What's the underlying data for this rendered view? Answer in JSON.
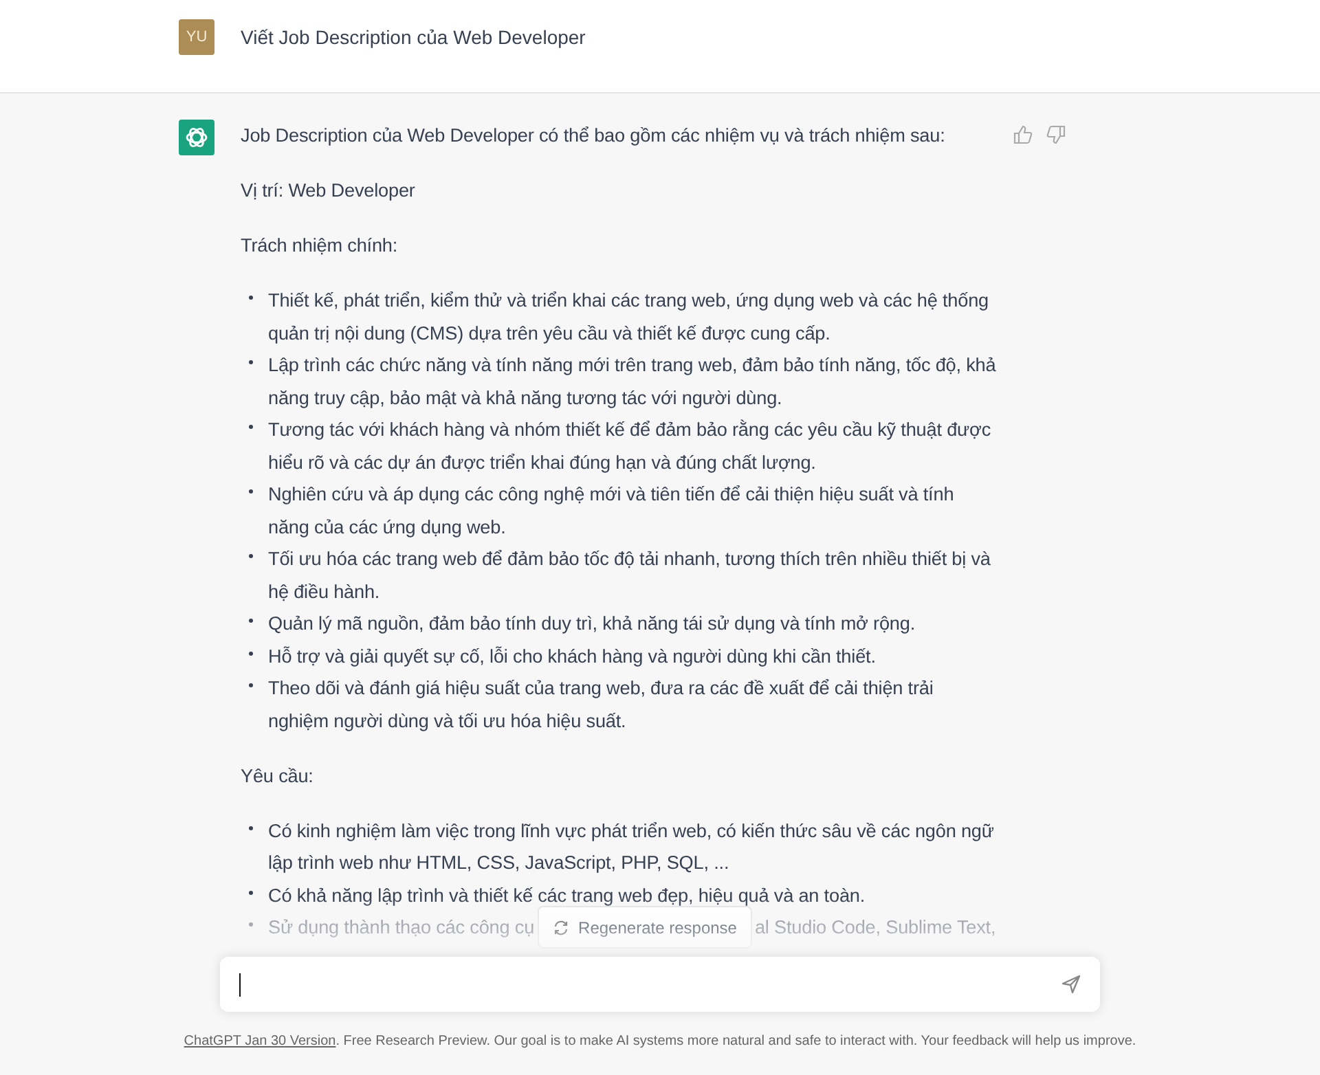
{
  "user_message": {
    "avatar": "YU",
    "text": "Viết Job Description của Web Developer"
  },
  "assistant_message": {
    "intro": "Job Description của Web Developer có thể bao gồm các nhiệm vụ và trách nhiệm sau:",
    "position": "Vị trí: Web Developer",
    "responsibilities_heading": "Trách nhiệm chính:",
    "responsibilities": [
      "Thiết kế, phát triển, kiểm thử và triển khai các trang web, ứng dụng web và các hệ thống quản trị nội dung (CMS) dựa trên yêu cầu và thiết kế được cung cấp.",
      "Lập trình các chức năng và tính năng mới trên trang web, đảm bảo tính năng, tốc độ, khả năng truy cập, bảo mật và khả năng tương tác với người dùng.",
      "Tương tác với khách hàng và nhóm thiết kế để đảm bảo rằng các yêu cầu kỹ thuật được hiểu rõ và các dự án được triển khai đúng hạn và đúng chất lượng.",
      "Nghiên cứu và áp dụng các công nghệ mới và tiên tiến để cải thiện hiệu suất và tính năng của các ứng dụng web.",
      "Tối ưu hóa các trang web để đảm bảo tốc độ tải nhanh, tương thích trên nhiều thiết bị và hệ điều hành.",
      "Quản lý mã nguồn, đảm bảo tính duy trì, khả năng tái sử dụng và tính mở rộng.",
      "Hỗ trợ và giải quyết sự cố, lỗi cho khách hàng và người dùng khi cần thiết.",
      "Theo dõi và đánh giá hiệu suất của trang web, đưa ra các đề xuất để cải thiện trải nghiệm người dùng và tối ưu hóa hiệu suất."
    ],
    "requirements_heading": "Yêu cầu:",
    "requirements": [
      "Có kinh nghiệm làm việc trong lĩnh vực phát triển web, có kiến thức sâu về các ngôn ngữ lập trình web như HTML, CSS, JavaScript, PHP, SQL, ...",
      "Có khả năng lập trình và thiết kế các trang web đẹp, hiệu quả và an toàn."
    ],
    "partial_requirement": {
      "before": "Sử dụng thành thạo các công cụ",
      "after": "al Studio Code, Sublime Text,"
    }
  },
  "regenerate_button": "Regenerate response",
  "footer": {
    "link": "ChatGPT Jan 30 Version",
    "text": ". Free Research Preview. Our goal is to make AI systems more natural and safe to interact with. Your feedback will help us improve."
  }
}
